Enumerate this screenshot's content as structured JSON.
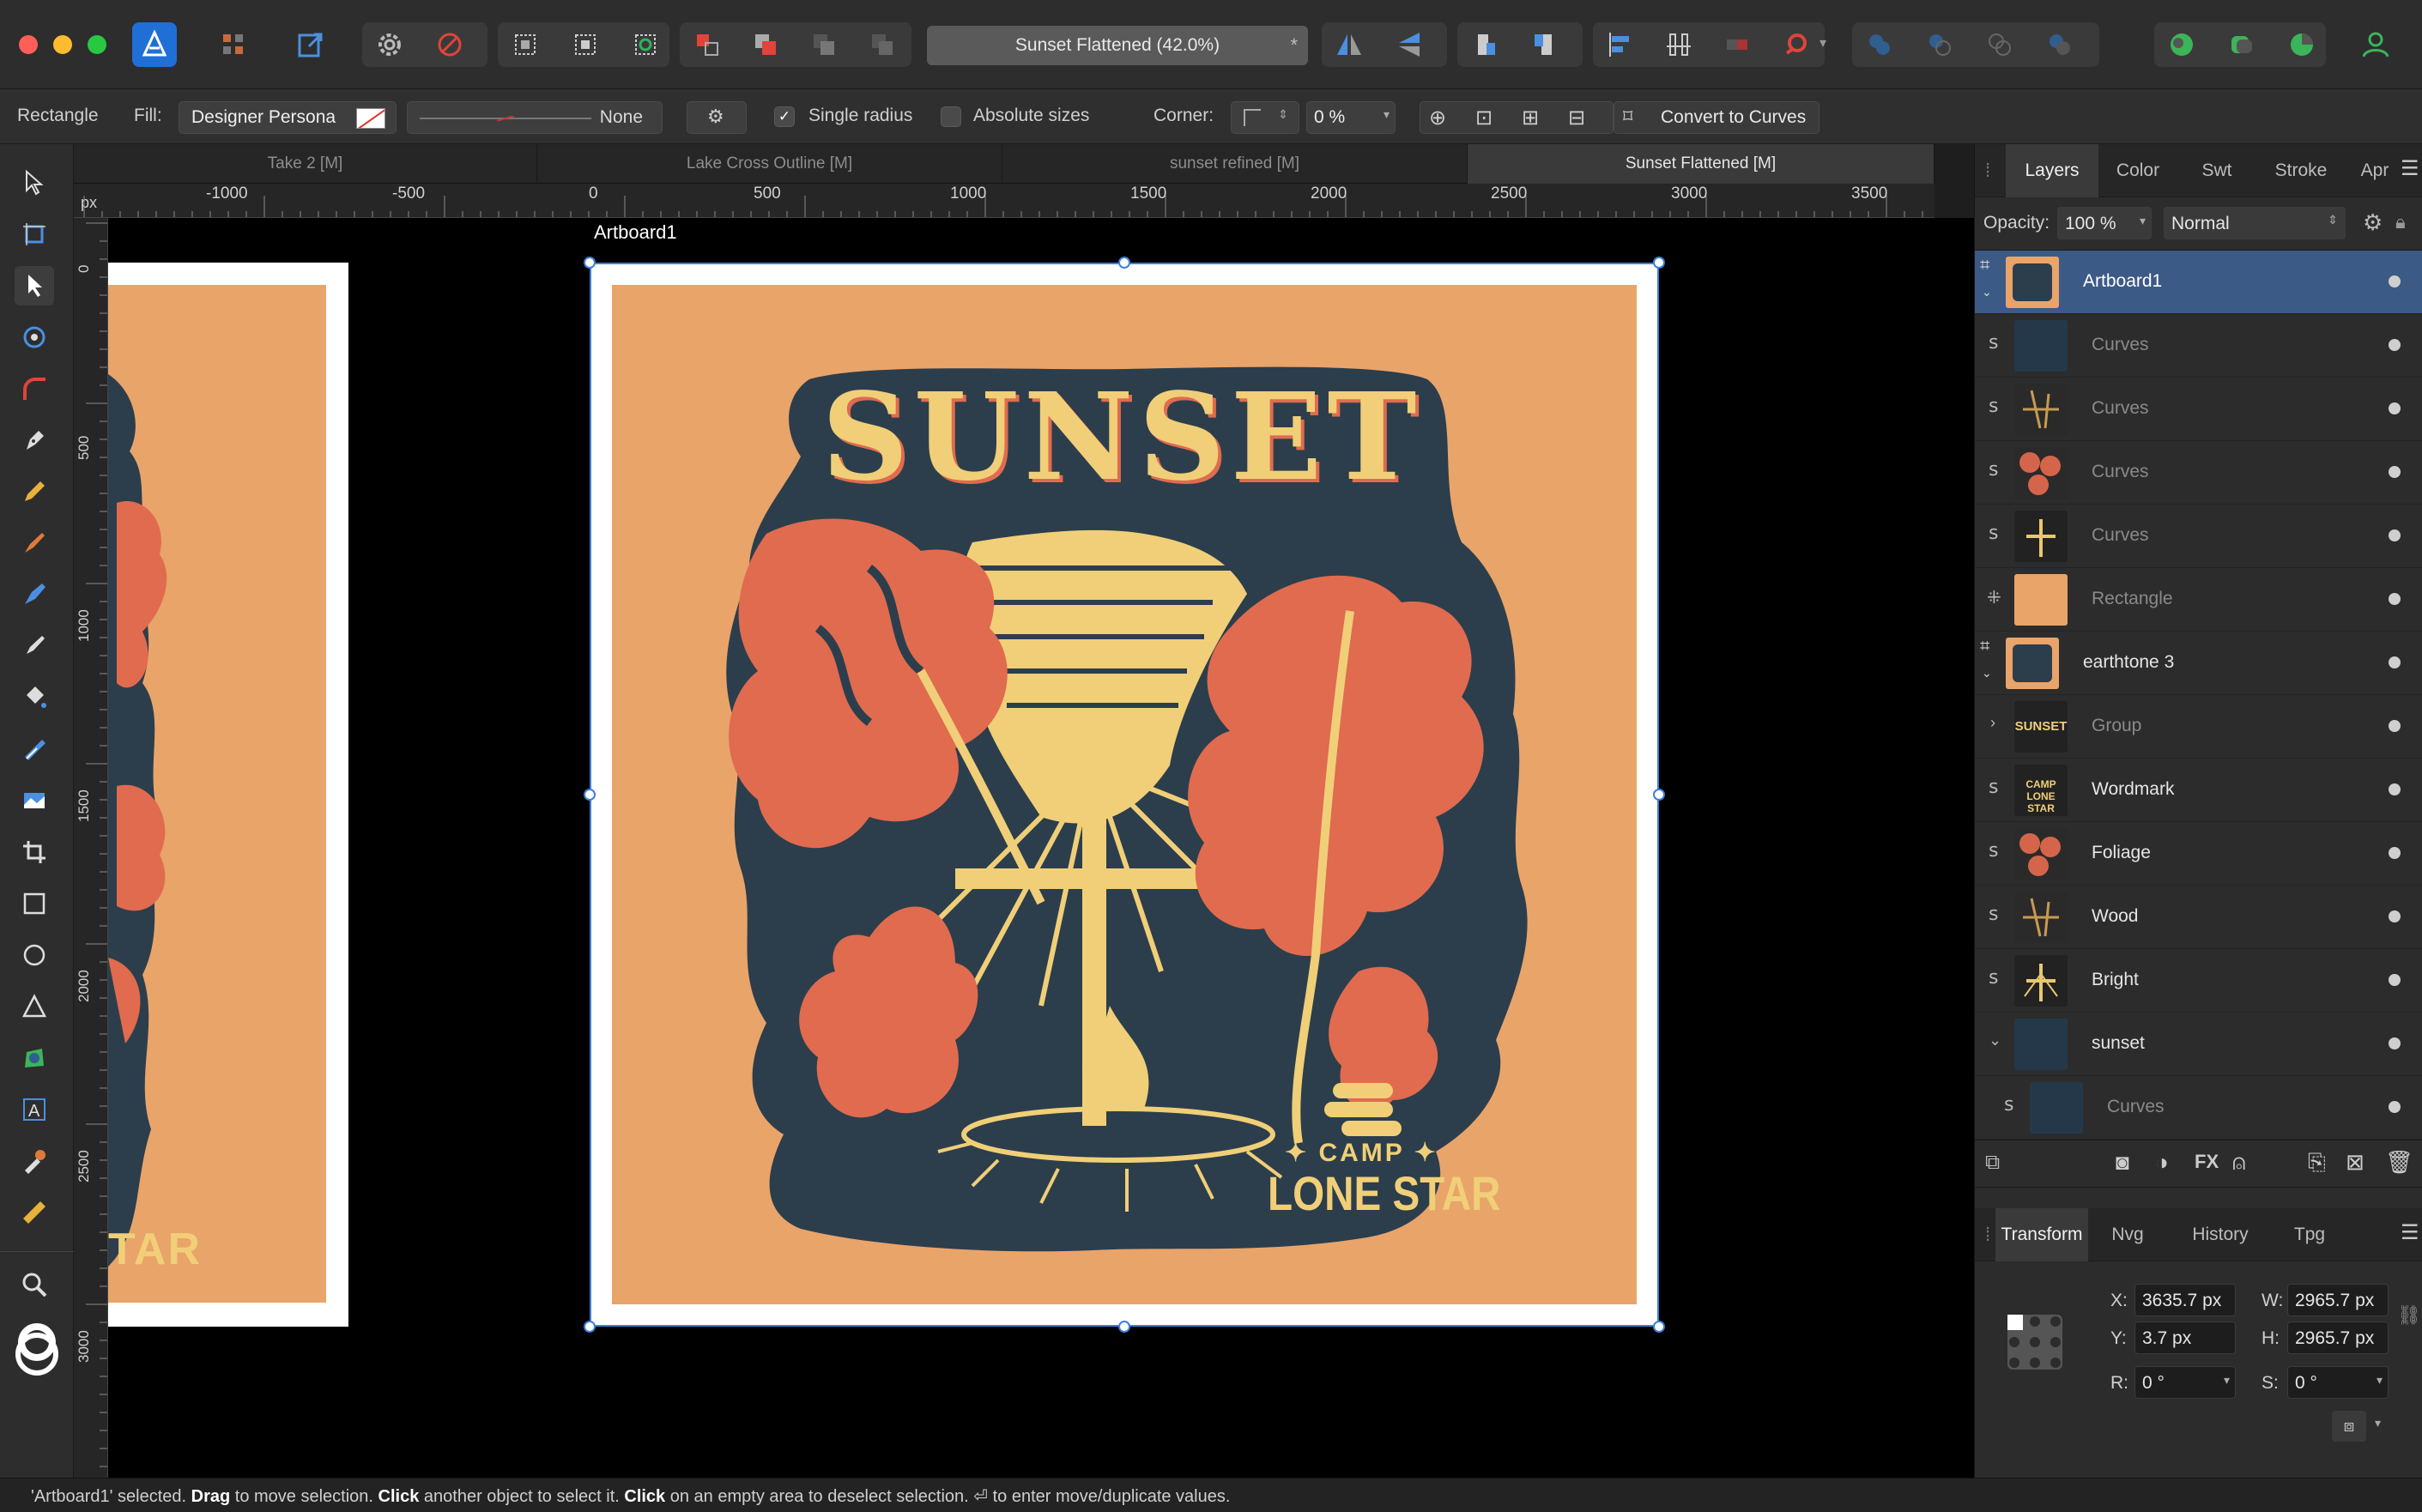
{
  "toolbar": {
    "document_title": "Sunset Flattened (42.0%)",
    "modified_mark": "*"
  },
  "context_toolbar": {
    "tool_name": "Rectangle",
    "fill_label": "Fill:",
    "persona_value": "Designer Persona",
    "stroke_value": "None",
    "single_radius_label": "Single radius",
    "single_radius_checked": true,
    "absolute_sizes_label": "Absolute sizes",
    "absolute_sizes_checked": false,
    "corner_label": "Corner:",
    "corner_percent": "0 %",
    "convert_label": "Convert to Curves"
  },
  "document_tabs": [
    {
      "label": "Take 2 [M]",
      "active": false
    },
    {
      "label": "Lake Cross Outline [M]",
      "active": false
    },
    {
      "label": "sunset refined [M]",
      "active": false
    },
    {
      "label": "Sunset Flattened [M]",
      "active": true
    }
  ],
  "rulers": {
    "unit": "px",
    "horizontal": [
      "-1000",
      "-500",
      "0",
      "500",
      "1000",
      "1500",
      "2000",
      "2500",
      "3000",
      "3500"
    ],
    "vertical": [
      "0",
      "500",
      "1000",
      "1500",
      "2000",
      "2500",
      "3000"
    ]
  },
  "canvas": {
    "artboard_label": "Artboard1",
    "artwork_title": "SUNSET",
    "artwork_camp": "✦ CAMP ✦",
    "artwork_lonestar": "LONE STAR",
    "left_fragment_text": "TAR"
  },
  "layers_panel": {
    "tabs": [
      "Layers",
      "Color",
      "Swt",
      "Stroke",
      "Apr"
    ],
    "active_tab": "Layers",
    "opacity_label": "Opacity:",
    "opacity_value": "100 %",
    "blend_mode": "Normal",
    "layers": [
      {
        "name": "Artboard1",
        "selected": true,
        "dimmed": false,
        "kind": "artboard"
      },
      {
        "name": "Curves",
        "selected": false,
        "dimmed": true,
        "kind": "curves"
      },
      {
        "name": "Curves",
        "selected": false,
        "dimmed": true,
        "kind": "curves"
      },
      {
        "name": "Curves",
        "selected": false,
        "dimmed": true,
        "kind": "curves"
      },
      {
        "name": "Curves",
        "selected": false,
        "dimmed": true,
        "kind": "curves"
      },
      {
        "name": "Rectangle",
        "selected": false,
        "dimmed": true,
        "kind": "rectangle"
      },
      {
        "name": "earthtone 3",
        "selected": false,
        "dimmed": false,
        "kind": "artboard"
      },
      {
        "name": "Group",
        "selected": false,
        "dimmed": true,
        "kind": "group"
      },
      {
        "name": "Wordmark",
        "selected": false,
        "dimmed": false,
        "kind": "curves"
      },
      {
        "name": "Foliage",
        "selected": false,
        "dimmed": false,
        "kind": "curves"
      },
      {
        "name": "Wood",
        "selected": false,
        "dimmed": false,
        "kind": "curves"
      },
      {
        "name": "Bright",
        "selected": false,
        "dimmed": false,
        "kind": "curves"
      },
      {
        "name": "sunset",
        "selected": false,
        "dimmed": false,
        "kind": "group-open"
      },
      {
        "name": "Curves",
        "selected": false,
        "dimmed": true,
        "kind": "curves"
      }
    ]
  },
  "transform_panel": {
    "tabs": [
      "Transform",
      "Nvg",
      "History",
      "Tpg"
    ],
    "active_tab": "Transform",
    "x_label": "X:",
    "x_value": "3635.7 px",
    "y_label": "Y:",
    "y_value": "3.7 px",
    "w_label": "W:",
    "w_value": "2965.7 px",
    "h_label": "H:",
    "h_value": "2965.7 px",
    "r_label": "R:",
    "r_value": "0 °",
    "s_label": "S:",
    "s_value": "0 °"
  },
  "status_bar": {
    "part1": "'Artboard1' selected. ",
    "drag": "Drag",
    "part2": " to move selection. ",
    "click1": "Click",
    "part3": " another object to select it. ",
    "click2": "Click",
    "part4": " on an empty area to deselect selection. ⏎ to enter move/duplicate values."
  },
  "colors": {
    "accent_blue": "#3c5a86",
    "artwork_orange": "#e9a46a",
    "artwork_navy": "#2c3e4c",
    "artwork_coral": "#e06b4e",
    "artwork_yellow": "#f0cf78"
  }
}
